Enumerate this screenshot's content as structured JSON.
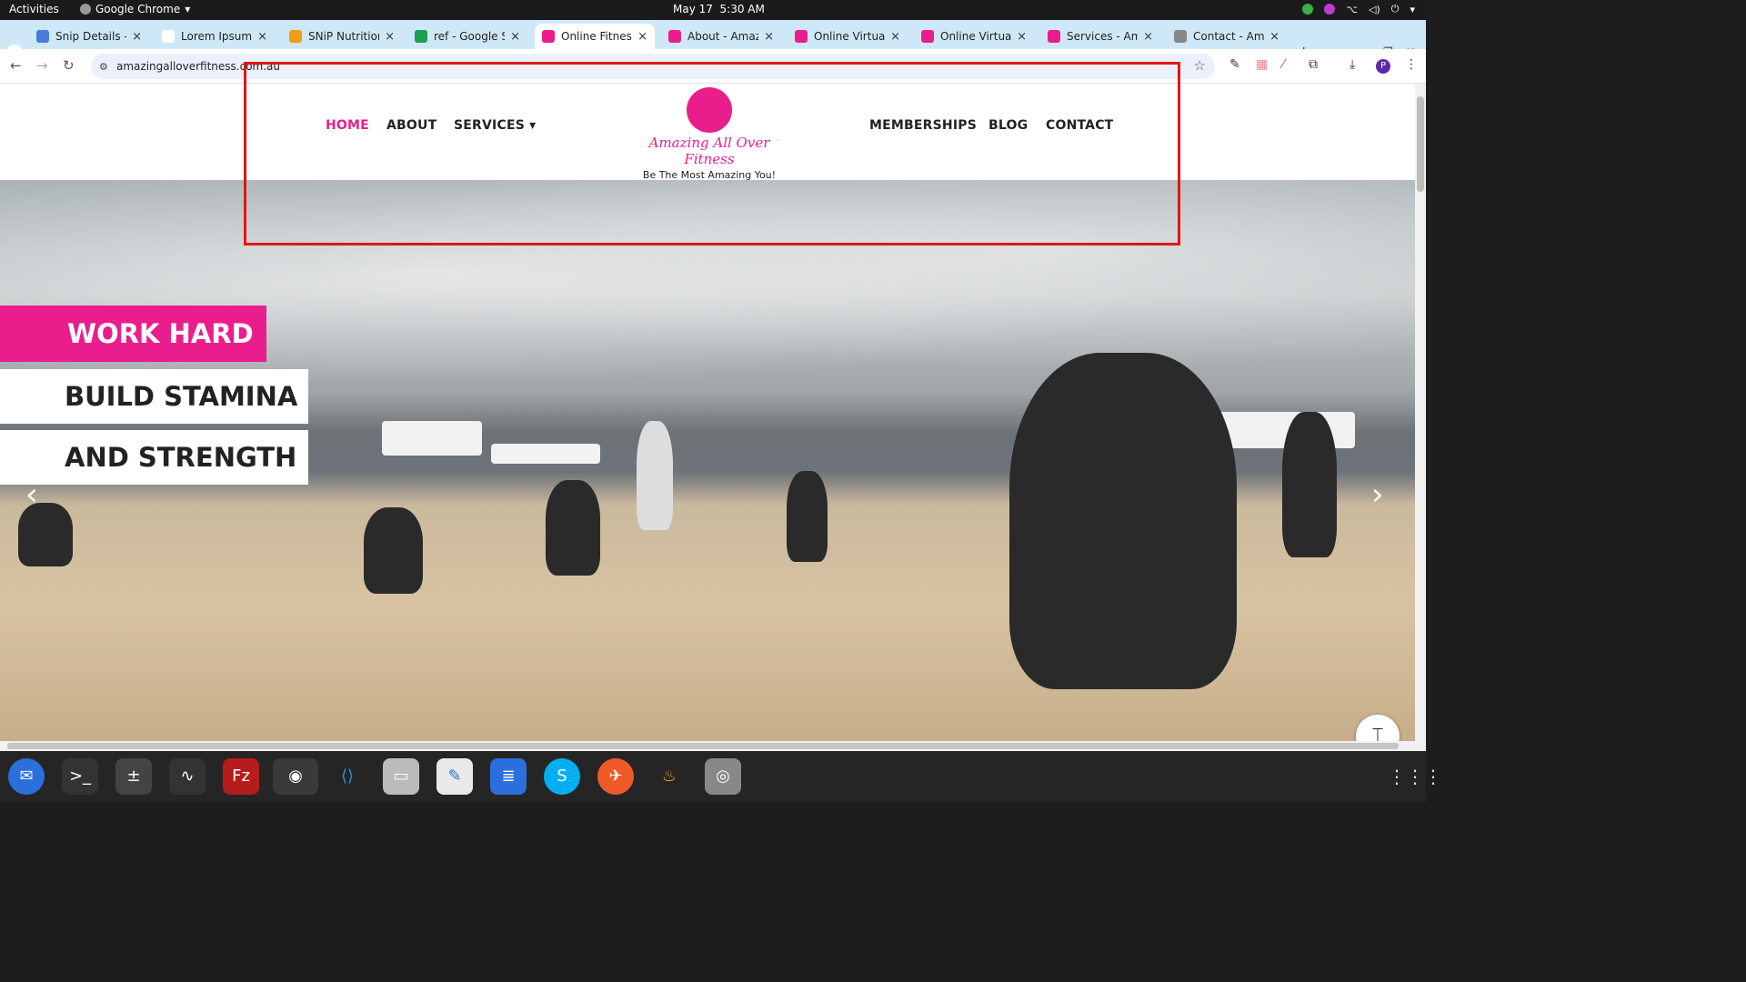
{
  "system": {
    "activities": "Activities",
    "app": "Google Chrome",
    "date": "May 17",
    "time": "5:30 AM"
  },
  "tabs": [
    {
      "title": "Snip Details - C",
      "color": "#4a7bd8"
    },
    {
      "title": "Lorem Ipsum -",
      "color": "#ffffff"
    },
    {
      "title": "SNiP Nutrition",
      "color": "#f39c12"
    },
    {
      "title": "ref - Google Sh",
      "color": "#1e9e50"
    },
    {
      "title": "Online Fitness",
      "color": "#e91e8c",
      "active": true
    },
    {
      "title": "About - Amazi",
      "color": "#e91e8c"
    },
    {
      "title": "Online Virtual",
      "color": "#e91e8c"
    },
    {
      "title": "Online Virtual",
      "color": "#e91e8c"
    },
    {
      "title": "Services - Ama",
      "color": "#e91e8c"
    },
    {
      "title": "Contact - Ama",
      "color": "#888888"
    }
  ],
  "toolbar": {
    "url": "amazingalloverfitness.com.au",
    "back": "←",
    "forward": "→",
    "reload": "↻",
    "new_tab": "+"
  },
  "site": {
    "nav_left": [
      "HOME",
      "ABOUT",
      "SERVICES ▾"
    ],
    "nav_right": [
      "MEMBERSHIPS",
      "BLOG",
      "CONTACT"
    ],
    "brand": "Amazing All Over Fitness",
    "tagline": "Be The Most Amazing You!",
    "accent": "#e91e8c"
  },
  "hero": {
    "slogan1": "WORK HARD",
    "slogan2": "BUILD STAMINA",
    "slogan3": "AND STRENGTH",
    "prev": "‹",
    "next": "›"
  },
  "icons": {
    "fab": "dumbbell-icon"
  }
}
